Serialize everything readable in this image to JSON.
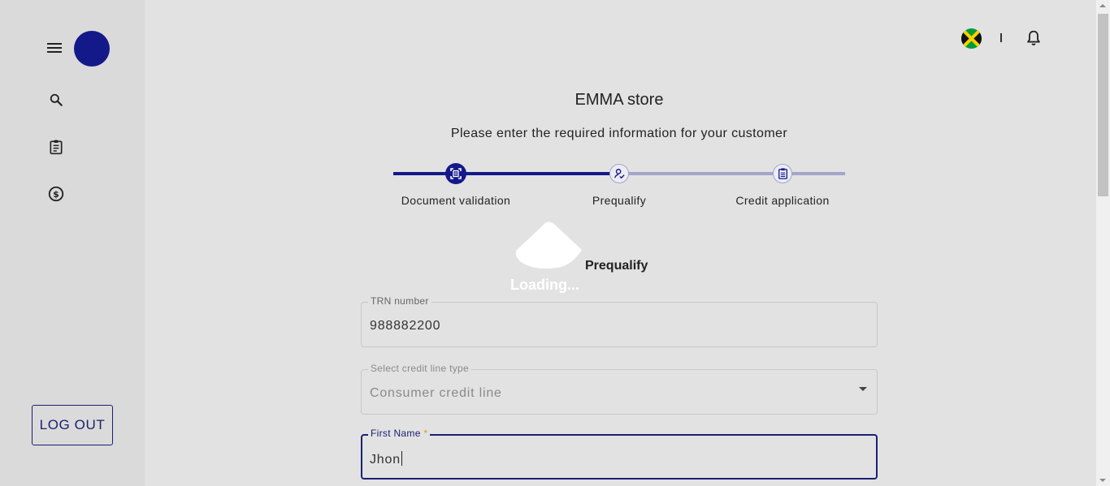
{
  "sidebar": {
    "nav": [
      "search-icon",
      "clipboard-icon",
      "dollar-icon"
    ],
    "logout_label": "LOG OUT"
  },
  "topbar": {
    "flag": "jamaica-flag-icon",
    "divider_text": "|",
    "bell": "bell-icon"
  },
  "page": {
    "store_title": "EMMA store",
    "subtitle": "Please enter the required information for your customer"
  },
  "stepper": {
    "steps": [
      {
        "label": "Document validation",
        "icon": "document-scan-icon",
        "state": "active"
      },
      {
        "label": "Prequalify",
        "icon": "person-check-icon",
        "state": "current"
      },
      {
        "label": "Credit application",
        "icon": "form-icon",
        "state": "upcoming"
      }
    ]
  },
  "loading": {
    "text": "Loading..."
  },
  "section": {
    "title": "Prequalify"
  },
  "form": {
    "trn": {
      "label": "TRN number",
      "value": "988882200"
    },
    "credit_line": {
      "label": "Select credit line type",
      "value": "Consumer credit line"
    },
    "first_name": {
      "label": "First Name",
      "required_mark": "*",
      "value": "Jhon"
    }
  },
  "colors": {
    "primary": "#14198a",
    "primary_dark": "#1c2070",
    "step_inactive": "#a3a5c9",
    "background": "#e2e2e2",
    "sidebar": "#dadada",
    "required": "#e0a000"
  }
}
